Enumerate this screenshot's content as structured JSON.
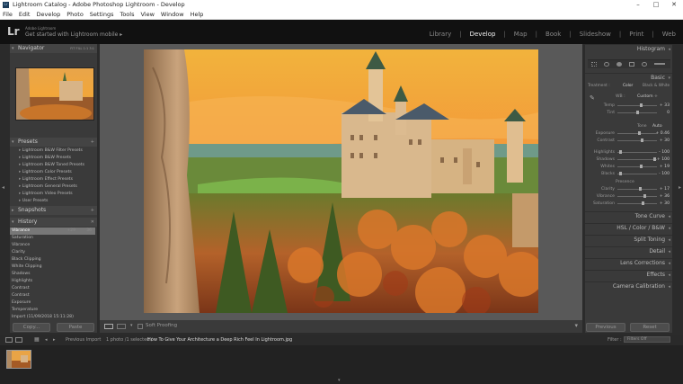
{
  "window": {
    "title": "Lightroom Catalog - Adobe Photoshop Lightroom - Develop",
    "controls": [
      "–",
      "□",
      "✕"
    ]
  },
  "menu": [
    "File",
    "Edit",
    "Develop",
    "Photo",
    "Settings",
    "Tools",
    "View",
    "Window",
    "Help"
  ],
  "identity": {
    "logo": "Lr",
    "small": "Adobe Lightroom",
    "big": "Get started with Lightroom mobile",
    "arrow": "▸"
  },
  "modules": [
    "Library",
    "Develop",
    "Map",
    "Book",
    "Slideshow",
    "Print",
    "Web"
  ],
  "left": {
    "navigator": {
      "title": "Navigator",
      "options": "FIT  FILL  1:1  3:1"
    },
    "presets": {
      "title": "Presets",
      "items": [
        "Lightroom B&W Filter Presets",
        "Lightroom B&W Presets",
        "Lightroom B&W Toned Presets",
        "Lightroom Color Presets",
        "Lightroom Effect Presets",
        "Lightroom General Presets",
        "Lightroom Video Presets",
        "User Presets"
      ]
    },
    "snapshots": {
      "title": "Snapshots"
    },
    "history": {
      "title": "History",
      "items": [
        {
          "name": "Vibrance",
          "v": "+29",
          "v2": "36"
        },
        {
          "name": "Saturation",
          "v": "",
          "v2": ""
        },
        {
          "name": "Vibrance",
          "v": "",
          "v2": ""
        },
        {
          "name": "Clarity",
          "v": "",
          "v2": ""
        },
        {
          "name": "Black Clipping",
          "v": "",
          "v2": ""
        },
        {
          "name": "White Clipping",
          "v": "",
          "v2": ""
        },
        {
          "name": "Shadows",
          "v": "",
          "v2": ""
        },
        {
          "name": "Highlights",
          "v": "",
          "v2": ""
        },
        {
          "name": "Contrast",
          "v": "",
          "v2": ""
        },
        {
          "name": "Contrast",
          "v": "",
          "v2": ""
        },
        {
          "name": "Exposure",
          "v": "",
          "v2": ""
        },
        {
          "name": "Temperature",
          "v": "",
          "v2": ""
        },
        {
          "name": "Import (11/09/2018 15:11:28)",
          "v": "",
          "v2": ""
        }
      ]
    },
    "copy": "Copy...",
    "paste": "Paste"
  },
  "right": {
    "histogram": "Histogram",
    "basic": "Basic",
    "treatment": {
      "label": "Treatment :",
      "color": "Color",
      "bw": "Black & White"
    },
    "wb": {
      "label": "WB :",
      "value": "Custom ÷"
    },
    "sliders": [
      {
        "name": "Temp",
        "val": "+ 33",
        "pos": 0.6
      },
      {
        "name": "Tint",
        "val": "0",
        "pos": 0.5
      },
      {
        "name": "Exposure",
        "val": "+ 0.46",
        "pos": 0.55
      },
      {
        "name": "Contrast",
        "val": "+ 30",
        "pos": 0.62
      },
      {
        "name": "Highlights",
        "val": "- 100",
        "pos": 0.05
      },
      {
        "name": "Shadows",
        "val": "+ 100",
        "pos": 0.95
      },
      {
        "name": "Whites",
        "val": "+ 19",
        "pos": 0.6
      },
      {
        "name": "Blacks",
        "val": "- 100",
        "pos": 0.05
      },
      {
        "name": "Clarity",
        "val": "+ 17",
        "pos": 0.58
      },
      {
        "name": "Vibrance",
        "val": "+ 36",
        "pos": 0.68
      },
      {
        "name": "Saturation",
        "val": "+ 30",
        "pos": 0.65
      }
    ],
    "tone": {
      "label": "Tone",
      "auto": "Auto"
    },
    "presence": "Presence",
    "sections": [
      "Tone Curve",
      "HSL / Color / B&W",
      "Split Toning",
      "Detail",
      "Lens Corrections",
      "Effects",
      "Camera Calibration"
    ],
    "previous": "Previous",
    "reset": "Reset"
  },
  "toolbar": {
    "soft_proofing": "Soft Proofing"
  },
  "filmstrip": {
    "prev_import": "Previous Import",
    "info": "1 photo /1 selected /",
    "file": "How To Give Your Architecture a Deep Rich Feel In Lightroom.jpg",
    "filter": "Filter :",
    "filter_val": "Filters Off"
  }
}
